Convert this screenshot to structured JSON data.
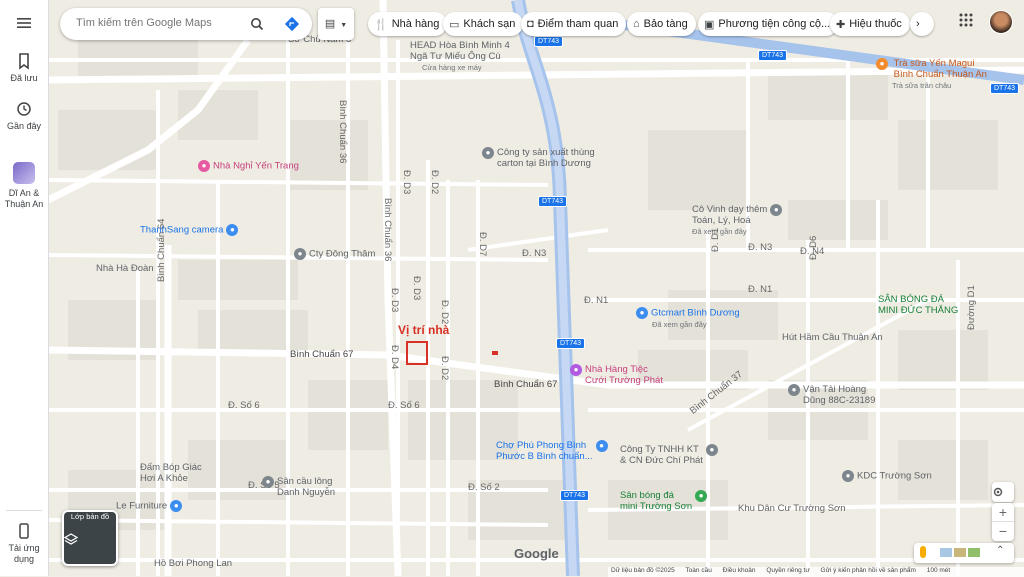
{
  "sidebar": {
    "saved_label": "Đã lưu",
    "recent_label": "Gần đây",
    "recent_place": "Dĩ An & Thuận An",
    "app_label": "Tải ứng dụng"
  },
  "search": {
    "placeholder": "Tìm kiếm trên Google Maps"
  },
  "chips": [
    "Nhà hàng",
    "Khách sạn",
    "Điểm tham quan",
    "Bảo tàng",
    "Phương tiện công cộ...",
    "Hiệu thuốc"
  ],
  "layers_label": "Lớp bản đồ",
  "highlight_label": "Vị trí nhà",
  "roads": {
    "binh_chuan_36": "Bình Chuẩn 36",
    "binh_chuan_64": "Bình Chuẩn 64",
    "binh_chuan_67a": "Bình Chuẩn 67",
    "binh_chuan_67b": "Bình Chuẩn 67",
    "binh_chuan_37": "Bình Chuẩn 37",
    "duong_d1": "Đường D1",
    "d3a": "Đ. D3",
    "d3b": "Đ. D3",
    "d3c": "Đ. D3",
    "d4": "Đ. D4",
    "d2a": "Đ. D2",
    "d2b": "Đ. D2",
    "d2c": "Đ. D2",
    "d7": "Đ. D7",
    "d1": "Đ. D1",
    "d6": "Đ. D6",
    "n1": "Đ. N1",
    "n3": "Đ. N3",
    "n3b": "Đ. N3",
    "n4": "Đ. N4",
    "n1b": "Đ. N1",
    "so6a": "Đ. Số 6",
    "so6b": "Đ. Số 6",
    "so2": "Đ. Số 2",
    "so5": "Đ. Số 5",
    "dt743": "DT743",
    "kdc": "Khu Dân Cư Trường Sơn"
  },
  "pois": {
    "head": "HEAD Hòa Bình Minh 4",
    "head_sub": "Cửa hàng xe máy",
    "mieu": "Ngã Tư Miếu Ông Cù",
    "chu_nam": "Sơ Chủ Nam 3",
    "tra_sua": "Trà sữa Yến Magui\nBình Chuẩn Thuận An",
    "tra_sua_sub": "Trà sữa trân châu",
    "nha_nghi": "Nhà Nghỉ Yến Trang",
    "carton": "Công ty sản xuất thùng\ncarton tại Bình Dương",
    "thanh_sang": "ThanhSang camera",
    "cty_dong_tham": "Cty Đông Thâm",
    "nha_ha_doan": "Nhà Hà Đoàn",
    "co_vinh": "Cô Vinh dạy thêm\nToán, Lý, Hoá",
    "co_vinh_sub": "Đã xem gần đây",
    "san_bong_mini": "SÂN BÓNG ĐÁ\nMINI ĐỨC THẮNG",
    "gtcmart": "Gtcmart Bình Dương",
    "gtcmart_sub": "Đã xem gần đây",
    "hut_ham": "Hút Hầm Cầu Thuận An",
    "nha_hang_tiec": "Nhà Hàng Tiệc\nCưới Trường Phát",
    "van_tai": "Vận Tải Hoàng\nDũng 88C-23189",
    "cho": "Chợ Phú Phong Bình\nPhước B Bình chuẩn...",
    "cong_ty_kt": "Công Ty TNHH KT\n& CN Đức Chí Phát",
    "kdc_truong_son": "KDC Trường Sơn",
    "dam_bop": "Đấm Bóp Giác\nHơi A Khỏe",
    "san_cau_long": "Sân cầu lông\nDanh Nguyễn",
    "le_furniture": "Le Furniture",
    "san_bong_ts": "Sân bóng đá\nmini Trường Sơn",
    "ho_boi": "Hồ Bơi Phong Lan"
  },
  "footer": {
    "data": "Dữ liệu bản đồ ©2025",
    "global": "Toàn cầu",
    "terms": "Điều khoản",
    "privacy": "Quyền riêng tư",
    "feedback": "Gửi ý kiến phản hồi về sản phẩm",
    "scale": "100 mét"
  },
  "google": "Google",
  "colors": {
    "accent": "#1a73e8",
    "highlight": "#d93025",
    "road": "#ffffff",
    "highway": "#8ab4f8"
  }
}
